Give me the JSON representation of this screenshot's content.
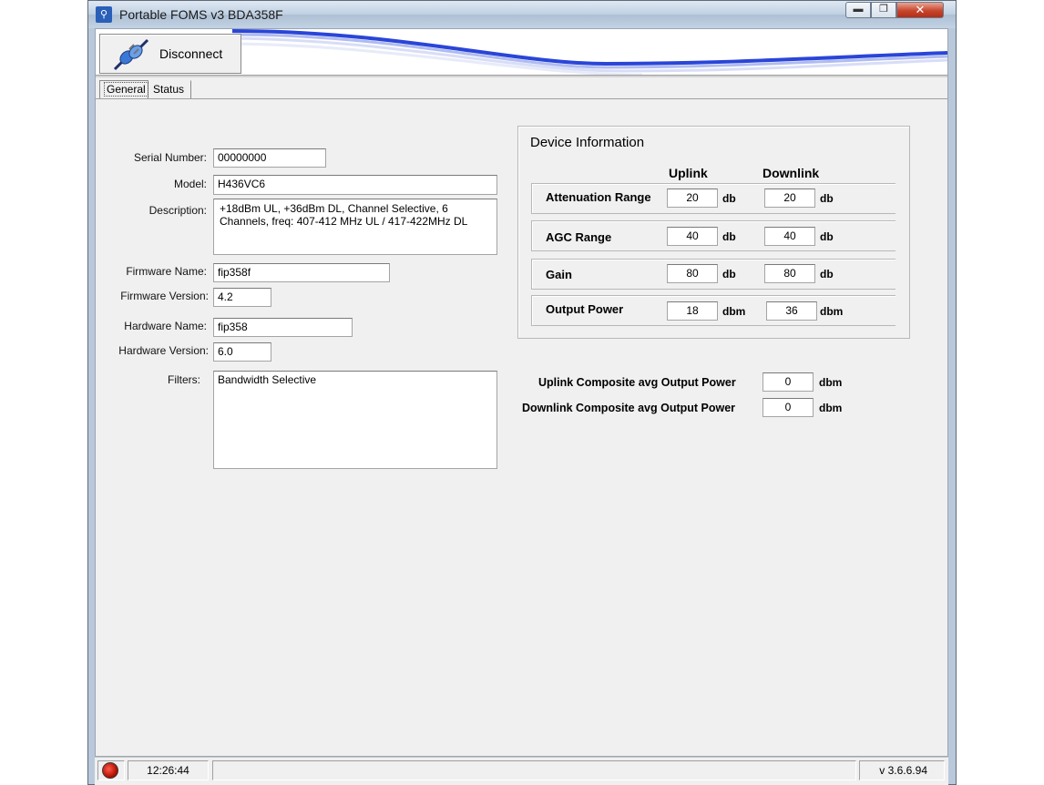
{
  "window": {
    "title": "Portable FOMS v3 BDA358F",
    "minimize": "▬",
    "maximize": "❐",
    "close": "✕"
  },
  "toolbar": {
    "disconnect_label": "Disconnect"
  },
  "tabs": [
    {
      "label": "General",
      "selected": true
    },
    {
      "label": "Status",
      "selected": false
    }
  ],
  "general": {
    "serial_number": {
      "label": "Serial Number:",
      "value": "00000000"
    },
    "model": {
      "label": "Model:",
      "value": "H436VC6"
    },
    "description": {
      "label": "Description:",
      "value": "+18dBm UL, +36dBm DL, Channel Selective, 6 Channels, freq: 407-412 MHz UL / 417-422MHz DL"
    },
    "firmware_name": {
      "label": "Firmware Name:",
      "value": "fip358f"
    },
    "firmware_version": {
      "label": "Firmware Version:",
      "value": "4.2"
    },
    "hardware_name": {
      "label": "Hardware Name:",
      "value": "fip358"
    },
    "hardware_version": {
      "label": "Hardware Version:",
      "value": "6.0"
    },
    "filters": {
      "label": "Filters:",
      "value": "Bandwidth Selective"
    }
  },
  "device_info": {
    "title": "Device Information",
    "uplink_header": "Uplink",
    "downlink_header": "Downlink",
    "rows": [
      {
        "label": "Attenuation Range",
        "uplink": "20",
        "uplink_unit": "db",
        "downlink": "20",
        "downlink_unit": "db"
      },
      {
        "label": "AGC Range",
        "uplink": "40",
        "uplink_unit": "db",
        "downlink": "40",
        "downlink_unit": "db"
      },
      {
        "label": "Gain",
        "uplink": "80",
        "uplink_unit": "db",
        "downlink": "80",
        "downlink_unit": "db"
      },
      {
        "label": "Output Power",
        "uplink": "18",
        "uplink_unit": "dbm",
        "downlink": "36",
        "downlink_unit": "dbm"
      }
    ]
  },
  "composite": {
    "uplink": {
      "label": "Uplink Composite avg Output Power",
      "value": "0",
      "unit": "dbm"
    },
    "downlink": {
      "label": "Downlink Composite avg Output Power",
      "value": "0",
      "unit": "dbm"
    }
  },
  "statusbar": {
    "time": "12:26:44",
    "version": "v 3.6.6.94",
    "led_color": "#cc1a0d"
  },
  "colors": {
    "header_swoosh": "#2a45d8"
  }
}
